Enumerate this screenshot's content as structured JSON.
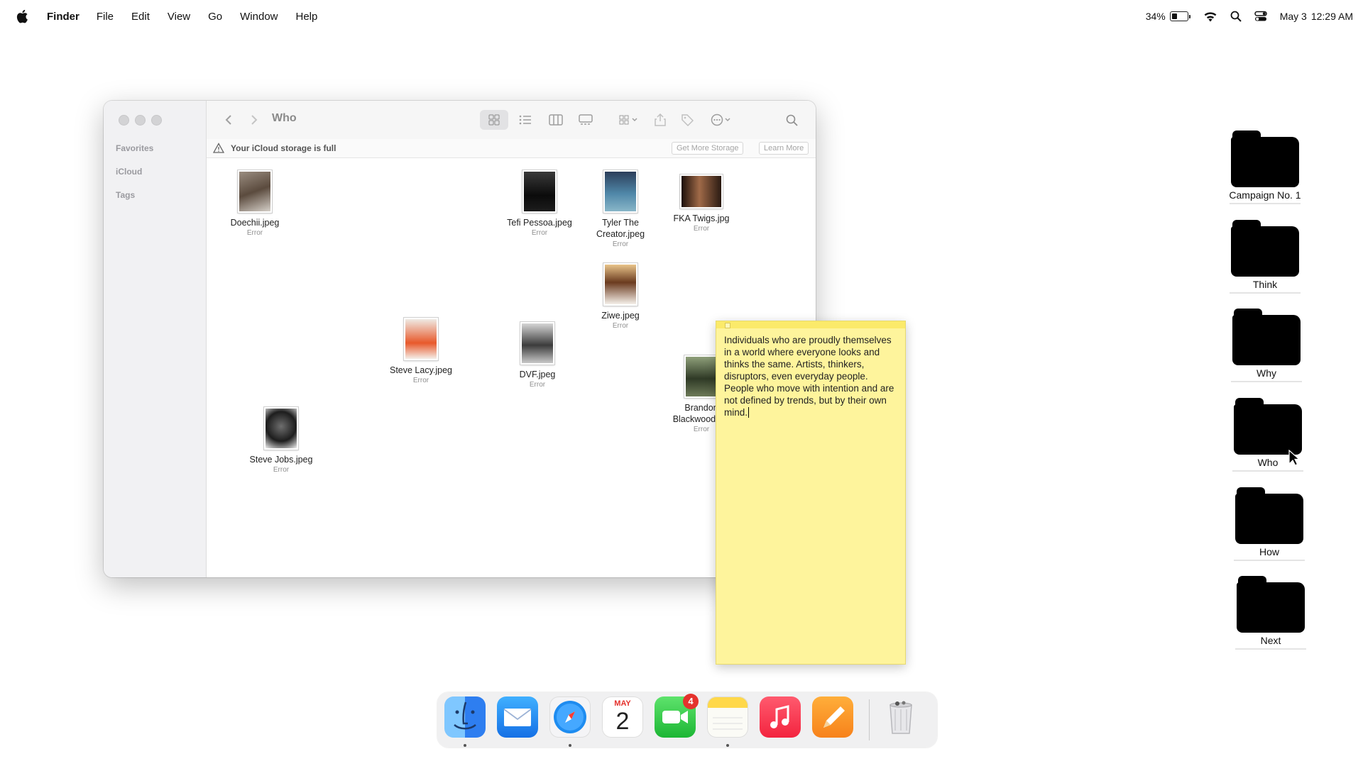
{
  "menubar": {
    "app": "Finder",
    "items": [
      "File",
      "Edit",
      "View",
      "Go",
      "Window",
      "Help"
    ],
    "battery": "34%",
    "date": "May 3",
    "time": "12:29 AM",
    "icons": [
      "apple-icon",
      "wifi-icon",
      "spotlight-icon",
      "control-center-icon"
    ]
  },
  "finder": {
    "title": "Who",
    "sidebar": [
      "Favorites",
      "iCloud",
      "Tags"
    ],
    "banner": {
      "text": "Your iCloud storage is full",
      "btn_storage": "Get More Storage",
      "btn_learn": "Learn More"
    },
    "files": [
      {
        "name": "Doechii.jpeg",
        "status": "Error",
        "tone": "#7a6a5c"
      },
      {
        "name": "Tefi Pessoa.jpeg",
        "status": "Error",
        "tone": "#1a1a1a"
      },
      {
        "name": "Tyler The Creator.jpeg",
        "status": "Error",
        "tone": "#3b6fa0"
      },
      {
        "name": "FKA Twigs.jpg",
        "status": "Error",
        "tone": "#8a5a3c"
      },
      {
        "name": "Ziwe.jpeg",
        "status": "Error",
        "tone": "#c58a4a"
      },
      {
        "name": "Steve Lacy.jpeg",
        "status": "Error",
        "tone": "#e36b3a"
      },
      {
        "name": "DVF.jpeg",
        "status": "Error",
        "tone": "#7c7c7c"
      },
      {
        "name": "Brandon Blackwood.jpg",
        "status": "Error",
        "tone": "#4e5e3e"
      },
      {
        "name": "Steve Jobs.jpeg",
        "status": "Error",
        "tone": "#2a2a2a"
      }
    ]
  },
  "sticky": {
    "text": "Individuals who are proudly themselves in a world where everyone looks and thinks the same. Artists, thinkers, disruptors, even everyday people. People who move with intention and are not defined by trends, but by their own mind."
  },
  "desktop": {
    "folders": [
      "Campaign No. 1",
      "Think",
      "Why",
      "Who",
      "How",
      "Next"
    ]
  },
  "dock": {
    "apps": [
      "Finder",
      "Mail",
      "Safari",
      "Calendar",
      "FaceTime",
      "Notes",
      "Music",
      "Pages",
      "Trash"
    ],
    "calendar_month": "MAY",
    "calendar_day": "2",
    "facetime_badge": "4"
  }
}
